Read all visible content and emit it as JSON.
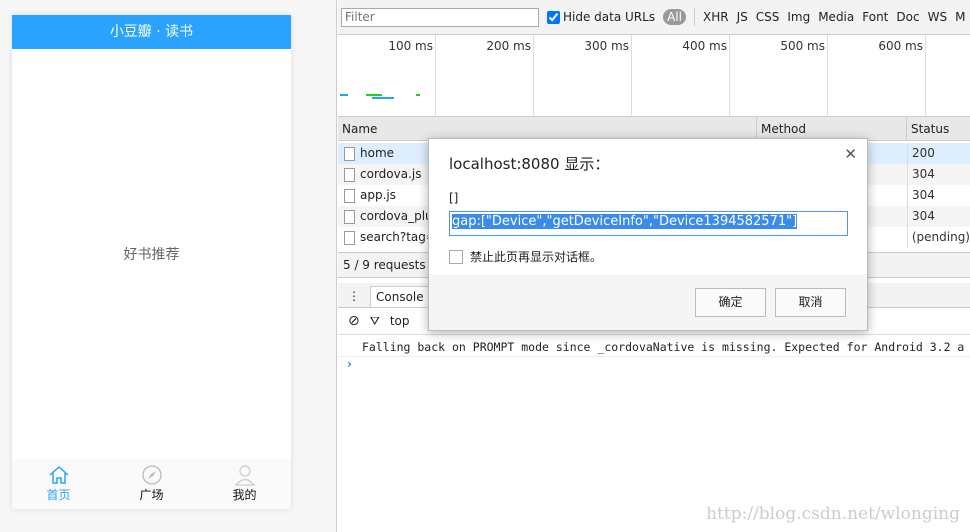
{
  "app": {
    "title": "小豆瓣 · 读书",
    "body_text": "好书推荐",
    "tabs": [
      {
        "label": "首页",
        "icon": "home-icon",
        "active": true
      },
      {
        "label": "广场",
        "icon": "compass-icon"
      },
      {
        "label": "我的",
        "icon": "user-icon"
      }
    ],
    "accent": "#29a3fd"
  },
  "devtools": {
    "filter_placeholder": "Filter",
    "hide_data_urls": "Hide data URLs",
    "hide_data_urls_checked": true,
    "types": [
      "All",
      "XHR",
      "JS",
      "CSS",
      "Img",
      "Media",
      "Font",
      "Doc",
      "WS",
      "M"
    ],
    "ticks": [
      "100 ms",
      "200 ms",
      "300 ms",
      "400 ms",
      "500 ms",
      "600 ms"
    ],
    "columns": [
      "Name",
      "Method",
      "Status"
    ],
    "rows": [
      {
        "name": "home",
        "status": "200"
      },
      {
        "name": "cordova.js",
        "status": "304"
      },
      {
        "name": "app.js",
        "status": "304"
      },
      {
        "name": "cordova_plug",
        "status": "304"
      },
      {
        "name": "search?tag=",
        "status": "(pending)"
      }
    ],
    "summary": "5 / 9 requests",
    "console_tab": "Console",
    "context": "top",
    "message": "Falling back on PROMPT mode since _cordovaNative is missing. Expected for Android 3.2 a"
  },
  "dialog": {
    "title": "localhost:8080 显示：",
    "message": "[]",
    "input_value": "gap:[\"Device\",\"getDeviceInfo\",\"Device1394582571\"]",
    "checkbox_label": "禁止此页再显示对话框。",
    "ok": "确定",
    "cancel": "取消"
  },
  "watermark": "http://blog.csdn.net/wlonging"
}
